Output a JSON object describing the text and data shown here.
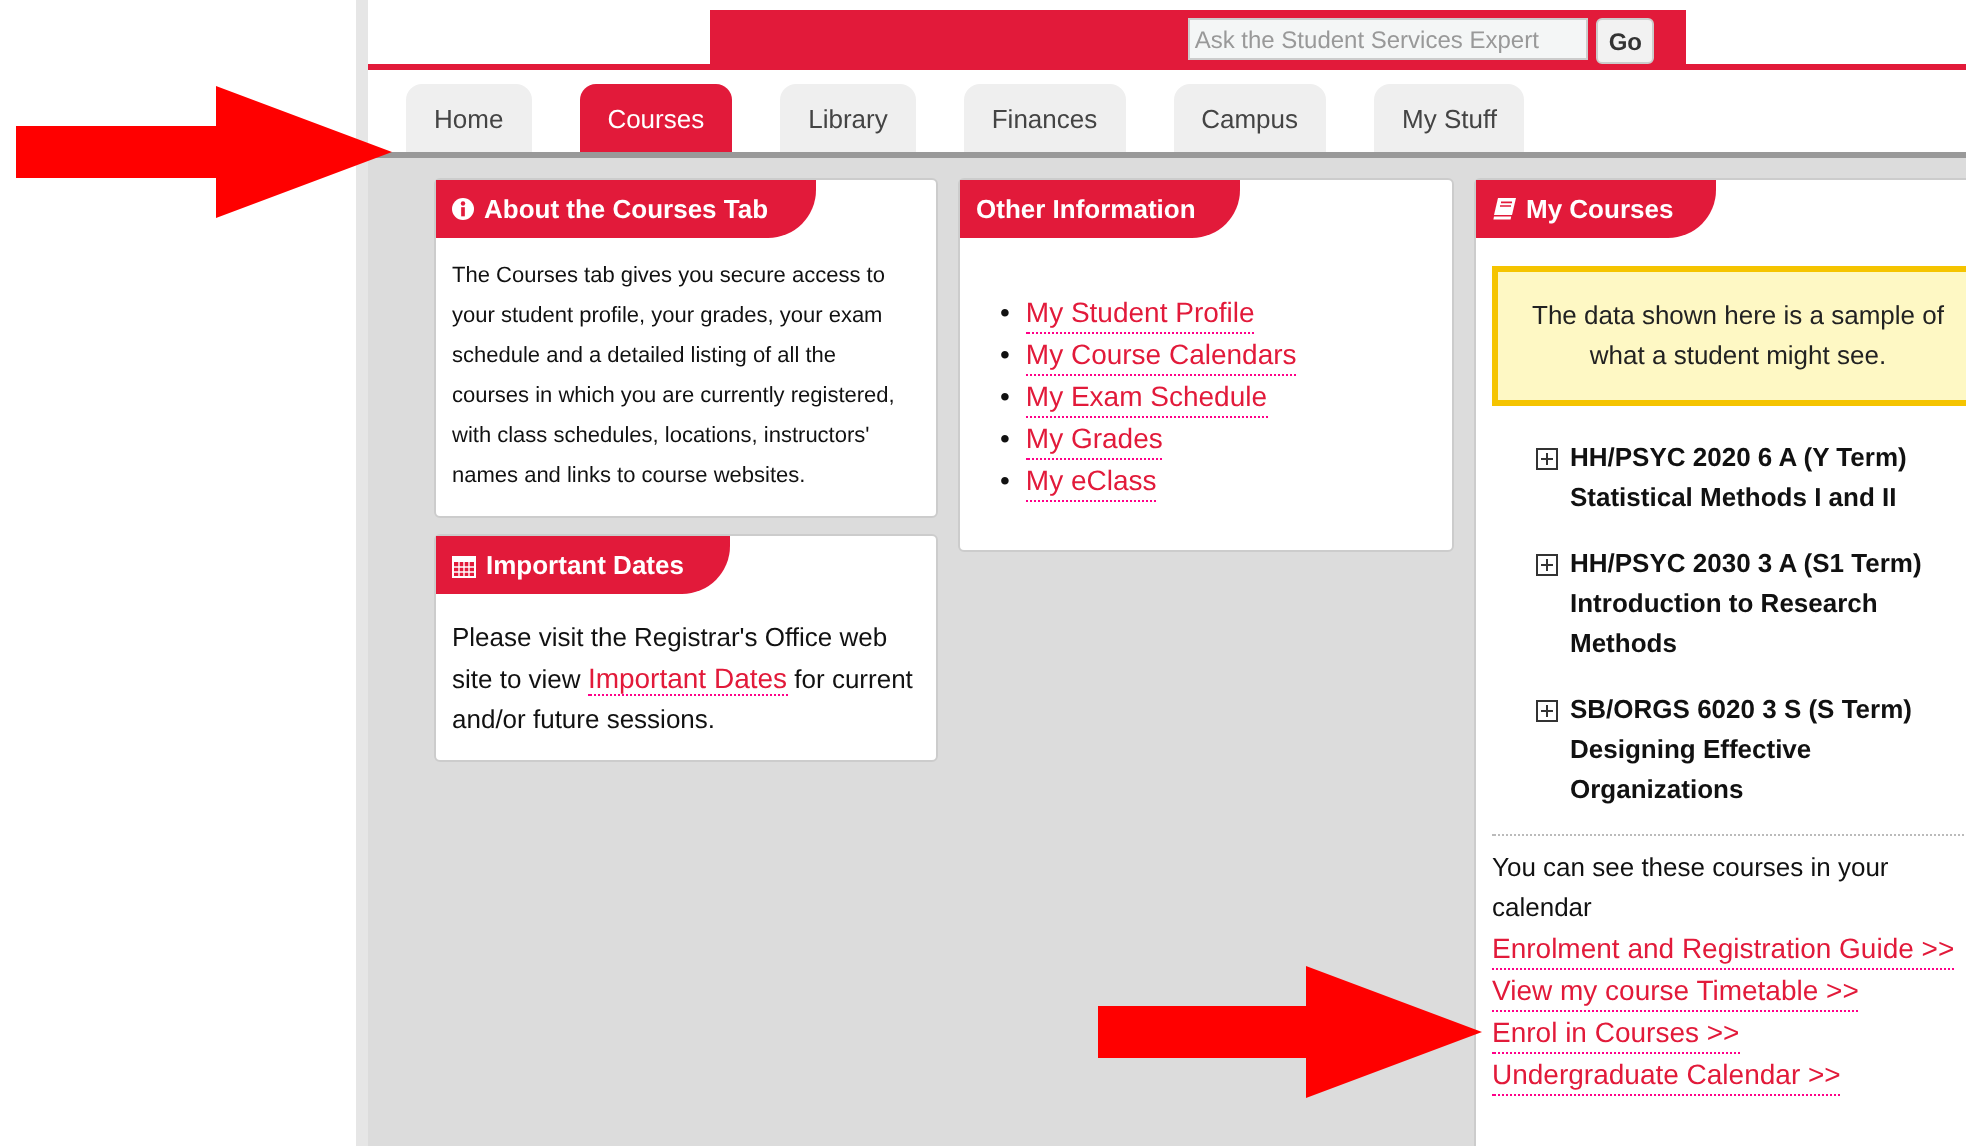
{
  "search": {
    "placeholder": "Ask the Student Services Expert",
    "button": "Go"
  },
  "tabs": [
    {
      "label": "Home",
      "selected": false
    },
    {
      "label": "Courses",
      "selected": true
    },
    {
      "label": "Library",
      "selected": false
    },
    {
      "label": "Finances",
      "selected": false
    },
    {
      "label": "Campus",
      "selected": false
    },
    {
      "label": "My Stuff",
      "selected": false
    }
  ],
  "about": {
    "title": "About the Courses Tab",
    "text": "The Courses tab gives you secure access to your student profile, your grades, your exam schedule and a detailed listing of all the courses in which you are currently registered, with class schedules, locations, instructors' names and links to course websites."
  },
  "important_dates": {
    "title": "Important Dates",
    "text_before": "Please visit the Registrar's Office web site to view",
    "link": "Important Dates",
    "text_after": "for current and/or future sessions."
  },
  "other_information": {
    "title": "Other Information",
    "links": [
      {
        "bullet": "•",
        "label": "My Student Profile"
      },
      {
        "bullet": "•",
        "label": "My Course Calendars"
      },
      {
        "bullet": "•",
        "label": "My Exam Schedule"
      },
      {
        "bullet": "•",
        "label": "My Grades"
      },
      {
        "bullet": "•",
        "label": "My eClass"
      }
    ]
  },
  "my_courses": {
    "title": "My Courses",
    "notice": "The data shown here is a sample of what a student might see.",
    "courses": [
      {
        "code": "HH/PSYC 2020 6 A (Y Term)",
        "name": "Statistical Methods I and II",
        "expanded": false
      },
      {
        "code": "HH/PSYC 2030 3 A (S1 Term)",
        "name": "Introduction to Research Methods",
        "expanded": false
      },
      {
        "code": "SB/ORGS 6020 3 S (S Term)",
        "name": "Designing Effective Organizations",
        "expanded": false
      }
    ],
    "calendar_note": "You can see these courses in your calendar",
    "links": [
      "Enrolment and Registration Guide >>",
      "View my course Timetable >>",
      "Enrol in Courses >>",
      "Undergraduate Calendar >>"
    ]
  }
}
